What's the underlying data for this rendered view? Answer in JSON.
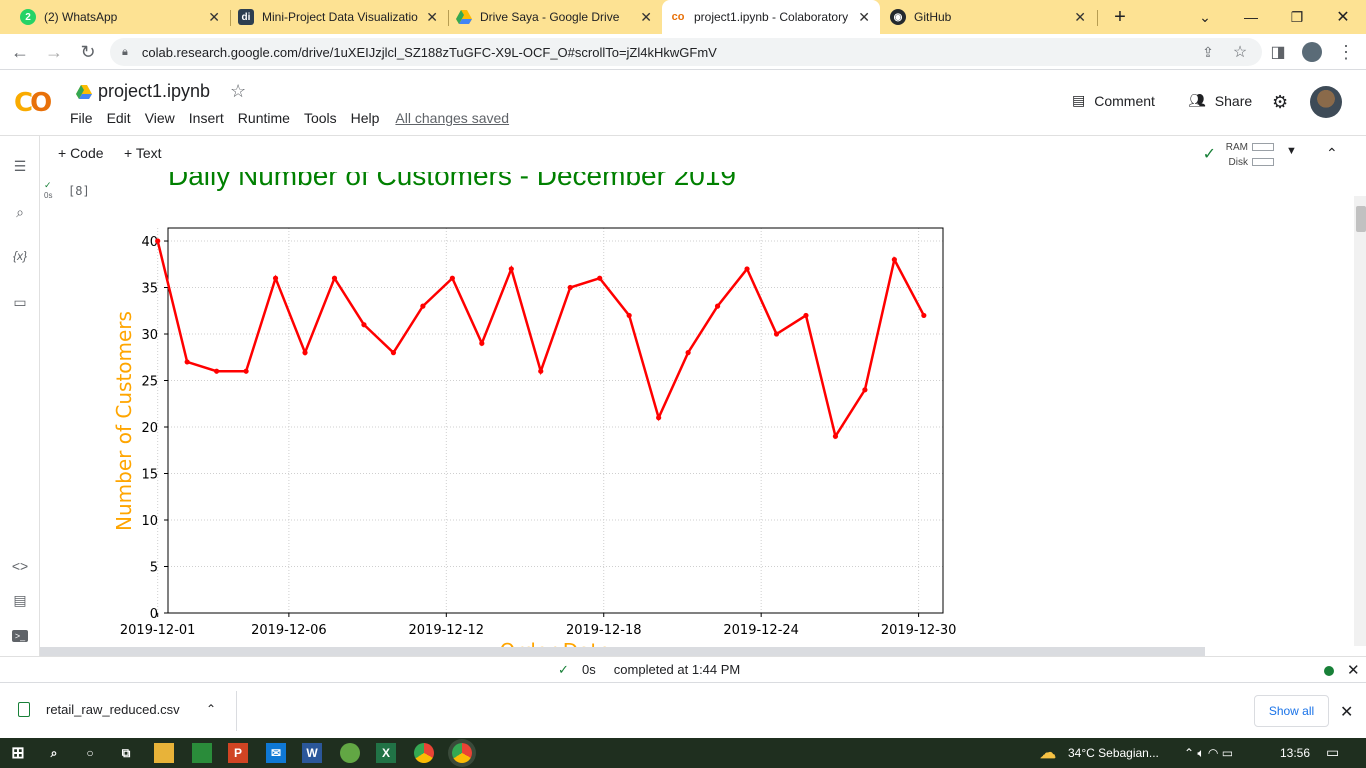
{
  "browser": {
    "tabs": [
      {
        "title": "(2) WhatsApp",
        "favicon": "whatsapp-icon",
        "color": "#25d366",
        "badge": "2"
      },
      {
        "title": "Mini-Project Data Visualizatio",
        "favicon": "dicoding-icon",
        "color": "#2d3e50",
        "badge": "di"
      },
      {
        "title": "Drive Saya - Google Drive",
        "favicon": "google-drive-icon",
        "color": "#34a853",
        "badge": ""
      },
      {
        "title": "project1.ipynb - Colaboratory",
        "favicon": "colab-icon",
        "color": "#f9ab00",
        "badge": "co"
      },
      {
        "title": "GitHub",
        "favicon": "github-icon",
        "color": "#24292e",
        "badge": ""
      }
    ],
    "url": "colab.research.google.com/drive/1uXEIJzjlcl_SZ188zTuGFC-X9L-OCF_O#scrollTo=jZl4kHkwGFmV"
  },
  "colab": {
    "notebook_title": "project1.ipynb",
    "menu": [
      "File",
      "Edit",
      "View",
      "Insert",
      "Runtime",
      "Tools",
      "Help"
    ],
    "save_status": "All changes saved",
    "comment_label": "Comment",
    "share_label": "Share",
    "add_code": "+ Code",
    "add_text": "+ Text",
    "ram_label": "RAM",
    "disk_label": "Disk",
    "cell_count": "[8]",
    "exec_time": "0s"
  },
  "chart_data": {
    "type": "line",
    "title": "Daily Number of Customers - December 2019",
    "xlabel": "Order Date",
    "ylabel": "Number of Customers",
    "x": [
      "2019-12-01",
      "2019-12-02",
      "2019-12-03",
      "2019-12-04",
      "2019-12-05",
      "2019-12-06",
      "2019-12-07",
      "2019-12-08",
      "2019-12-09",
      "2019-12-10",
      "2019-12-11",
      "2019-12-12",
      "2019-12-13",
      "2019-12-14",
      "2019-12-15",
      "2019-12-16",
      "2019-12-17",
      "2019-12-18",
      "2019-12-19",
      "2019-12-20",
      "2019-12-21",
      "2019-12-22",
      "2019-12-23",
      "2019-12-24",
      "2019-12-25",
      "2019-12-26",
      "2019-12-27",
      "2019-12-28",
      "2019-12-29",
      "2019-12-30",
      "2019-12-31"
    ],
    "series": [
      {
        "values": [
          40,
          27,
          26,
          26,
          36,
          28,
          36,
          31,
          28,
          33,
          36,
          29,
          37,
          26,
          35,
          36,
          32,
          21,
          28,
          33,
          37,
          30,
          32,
          19,
          24,
          38,
          32
        ]
      }
    ],
    "x_points": [
      0,
      1,
      2,
      3,
      4,
      5,
      6,
      7,
      8,
      9,
      10,
      11,
      12,
      13,
      14,
      15,
      16,
      17,
      18,
      19,
      20,
      21,
      22,
      23,
      24,
      25,
      26
    ],
    "x_tick_labels": [
      "2019-12-01",
      "2019-12-06",
      "2019-12-12",
      "2019-12-18",
      "2019-12-24",
      "2019-12-30"
    ],
    "x_tick_days": [
      1,
      6,
      12,
      18,
      24,
      30
    ],
    "yticks": [
      0,
      5,
      10,
      15,
      20,
      25,
      30,
      35,
      40
    ],
    "ylim": [
      0,
      41.4
    ],
    "line_color": "#ff0000",
    "title_color": "#008000",
    "label_color": "#ffa500",
    "grid": true
  },
  "status": {
    "time": "0s",
    "text": "completed at 1:44 PM"
  },
  "downloads": {
    "file": "retail_raw_reduced.csv",
    "show_all": "Show all"
  },
  "taskbar": {
    "weather": "34°C  Sebagian...",
    "clock": "13:56"
  }
}
